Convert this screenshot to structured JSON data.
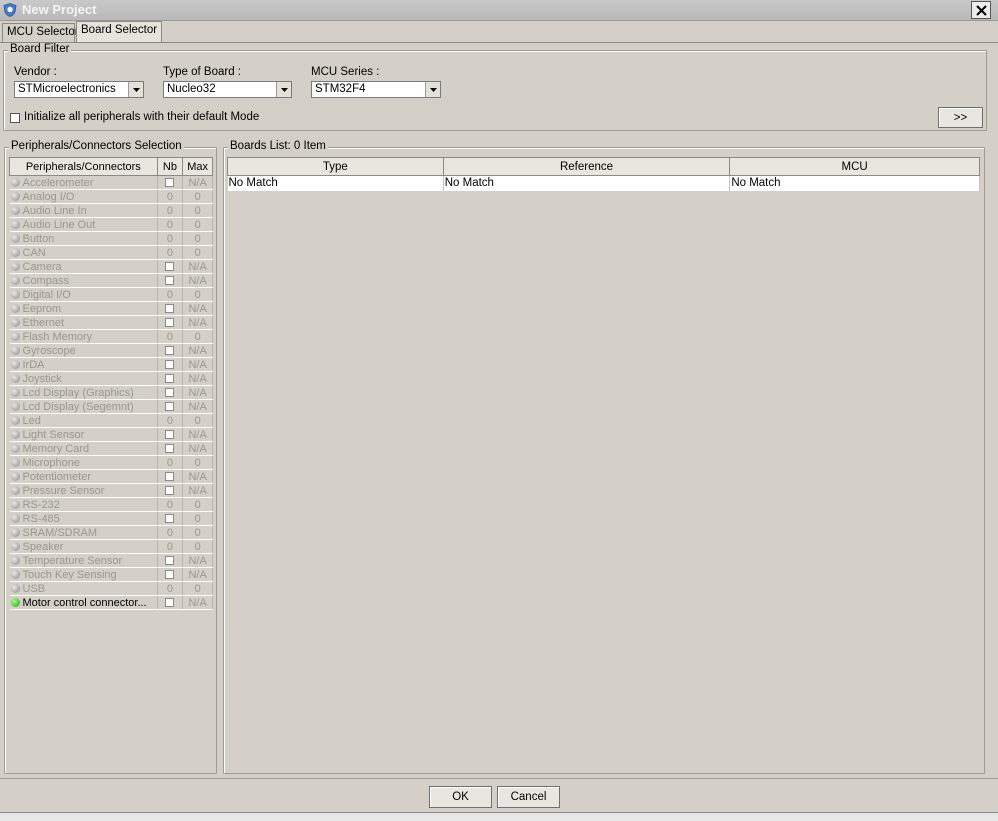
{
  "window": {
    "title": "New Project",
    "close_icon": "close-icon"
  },
  "tabs": [
    {
      "label": "MCU Selector",
      "active": false
    },
    {
      "label": "Board Selector",
      "active": true
    }
  ],
  "board_filter": {
    "group_label": "Board Filter",
    "vendor": {
      "label": "Vendor :",
      "value": "STMicroelectronics"
    },
    "type_of_board": {
      "label": "Type of Board :",
      "value": "Nucleo32"
    },
    "mcu_series": {
      "label": "MCU Series :",
      "value": "STM32F4"
    },
    "init_checkbox_label": "Initialize all peripherals with their default Mode",
    "init_checked": false,
    "expand_button_label": ">>"
  },
  "peripherals": {
    "group_label": "Peripherals/Connectors Selection",
    "headers": [
      "Peripherals/Connectors",
      "Nb",
      "Max"
    ],
    "rows": [
      {
        "name": "Accelerometer",
        "nb": "checkbox",
        "max": "N/A",
        "active": false
      },
      {
        "name": "Analog I/O",
        "nb": "0",
        "max": "0",
        "active": false
      },
      {
        "name": "Audio Line In",
        "nb": "0",
        "max": "0",
        "active": false
      },
      {
        "name": "Audio Line Out",
        "nb": "0",
        "max": "0",
        "active": false
      },
      {
        "name": "Button",
        "nb": "0",
        "max": "0",
        "active": false
      },
      {
        "name": "CAN",
        "nb": "0",
        "max": "0",
        "active": false
      },
      {
        "name": "Camera",
        "nb": "checkbox",
        "max": "N/A",
        "active": false
      },
      {
        "name": "Compass",
        "nb": "checkbox",
        "max": "N/A",
        "active": false
      },
      {
        "name": "Digital I/O",
        "nb": "0",
        "max": "0",
        "active": false
      },
      {
        "name": "Eeprom",
        "nb": "checkbox",
        "max": "N/A",
        "active": false
      },
      {
        "name": "Ethernet",
        "nb": "checkbox",
        "max": "N/A",
        "active": false
      },
      {
        "name": "Flash Memory",
        "nb": "0",
        "max": "0",
        "active": false
      },
      {
        "name": "Gyroscope",
        "nb": "checkbox",
        "max": "N/A",
        "active": false
      },
      {
        "name": "IrDA",
        "nb": "checkbox",
        "max": "N/A",
        "active": false
      },
      {
        "name": "Joystick",
        "nb": "checkbox",
        "max": "N/A",
        "active": false
      },
      {
        "name": "Lcd Display (Graphics)",
        "nb": "checkbox",
        "max": "N/A",
        "active": false
      },
      {
        "name": "Lcd Display (Segemnt)",
        "nb": "checkbox",
        "max": "N/A",
        "active": false
      },
      {
        "name": "Led",
        "nb": "0",
        "max": "0",
        "active": false
      },
      {
        "name": "Light Sensor",
        "nb": "checkbox",
        "max": "N/A",
        "active": false
      },
      {
        "name": "Memory Card",
        "nb": "checkbox",
        "max": "N/A",
        "active": false
      },
      {
        "name": "Microphone",
        "nb": "0",
        "max": "0",
        "active": false
      },
      {
        "name": "Potentiometer",
        "nb": "checkbox",
        "max": "N/A",
        "active": false
      },
      {
        "name": "Pressure Sensor",
        "nb": "checkbox",
        "max": "N/A",
        "active": false
      },
      {
        "name": "RS-232",
        "nb": "0",
        "max": "0",
        "active": false
      },
      {
        "name": "RS-485",
        "nb": "checkbox",
        "max": "0",
        "active": false
      },
      {
        "name": "SRAM/SDRAM",
        "nb": "0",
        "max": "0",
        "active": false
      },
      {
        "name": "Speaker",
        "nb": "0",
        "max": "0",
        "active": false
      },
      {
        "name": "Temperature Sensor",
        "nb": "checkbox",
        "max": "N/A",
        "active": false
      },
      {
        "name": "Touch Key Sensing",
        "nb": "checkbox",
        "max": "N/A",
        "active": false
      },
      {
        "name": "USB",
        "nb": "0",
        "max": "0",
        "active": false
      },
      {
        "name": "Motor control connector...",
        "nb": "checkbox",
        "max": "N/A",
        "active": true
      }
    ]
  },
  "boards_list": {
    "group_label": "Boards List: 0 Item",
    "headers": [
      "Type",
      "Reference",
      "MCU"
    ],
    "rows": [
      [
        "No Match",
        "No Match",
        "No Match"
      ]
    ]
  },
  "footer": {
    "ok_label": "OK",
    "cancel_label": "Cancel"
  },
  "colors": {
    "dialog_bg": "#d4d0c8",
    "active_dot": "#22c022",
    "inactive_text": "#9b978f"
  }
}
